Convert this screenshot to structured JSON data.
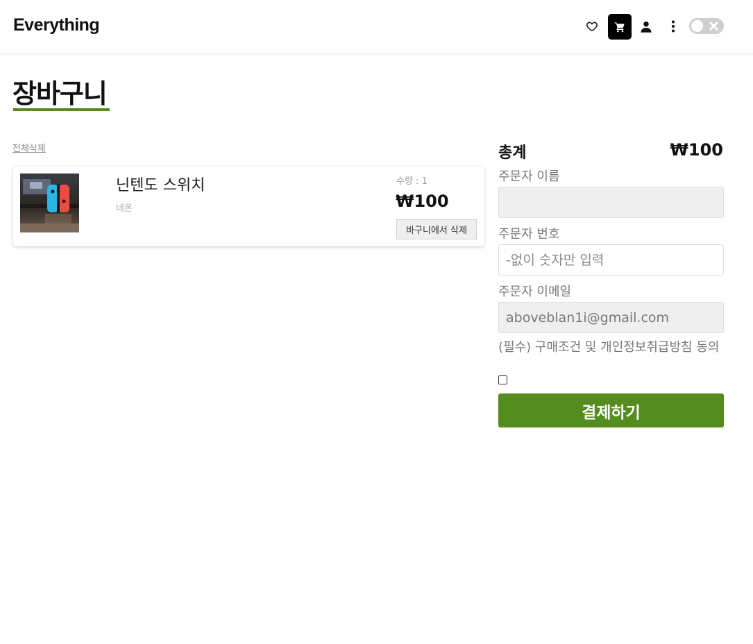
{
  "header": {
    "logo": "Everything",
    "icons": [
      "heart-icon",
      "cart-icon",
      "user-icon",
      "more-vertical-icon"
    ],
    "theme_toggle": {
      "state": "off"
    }
  },
  "page": {
    "title": "장바구니",
    "accent_color": "#548c1e"
  },
  "cart": {
    "delete_all_label": "전체삭제",
    "items": [
      {
        "name": "닌텐도 스위치",
        "option": "네온",
        "quantity_label": "수량 : 1",
        "price": "₩100",
        "remove_label": "바구니에서 삭제"
      }
    ]
  },
  "summary": {
    "total_label": "총계",
    "total_value": "₩100",
    "name_label": "주문자 이름",
    "name_value": "",
    "phone_label": "주문자 번호",
    "phone_placeholder": "-없이 숫자만 입력",
    "email_label": "주문자 이메일",
    "email_value": "aboveblan1i@gmail.com",
    "agree_label": "(필수) 구매조건 및 개인정보취급방침 동의",
    "agree_checked": false,
    "pay_label": "결제하기"
  }
}
